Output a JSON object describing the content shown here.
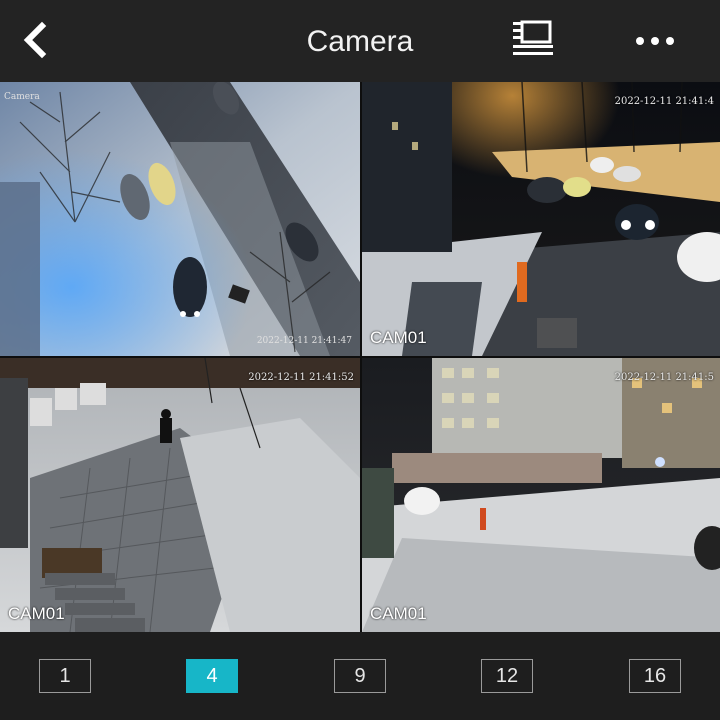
{
  "header": {
    "title": "Camera",
    "back_icon": "chevron-left-icon",
    "monitor_icon": "monitor-icon",
    "more_icon": "more-dots-icon"
  },
  "tiles": [
    {
      "label": "",
      "osd_title": "Camera",
      "timestamp": "2022-12-11 21:41:47",
      "selected": true
    },
    {
      "label": "CAM01",
      "timestamp": "2022-12-11 21:41:4"
    },
    {
      "label": "CAM01",
      "timestamp": "2022-12-11 21:41:52"
    },
    {
      "label": "CAM01",
      "timestamp": "2022-12-11 21:41:5"
    }
  ],
  "layouts": {
    "options": [
      "1",
      "4",
      "9",
      "12",
      "16"
    ],
    "active": "4"
  },
  "colors": {
    "accent": "#17b6c8",
    "selected_border": "#21c6d9"
  }
}
